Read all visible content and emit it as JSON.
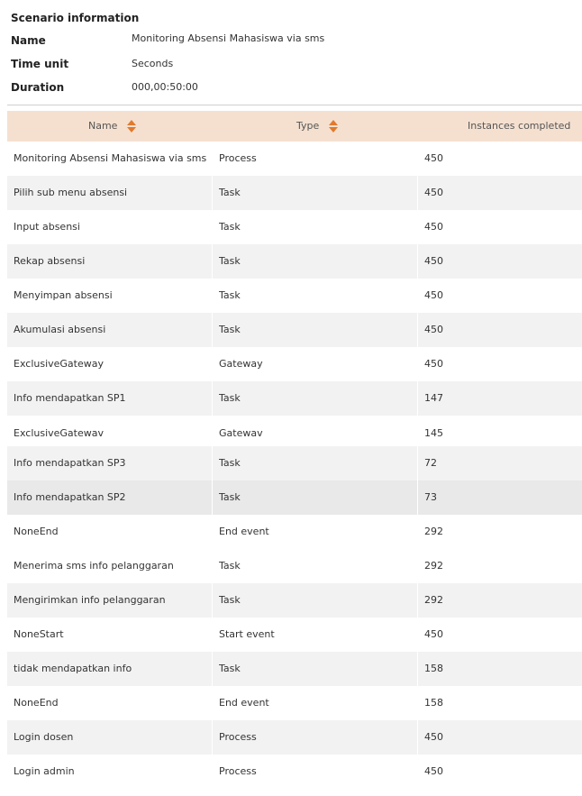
{
  "scenario": {
    "title": "Scenario information",
    "fields": [
      {
        "label": "Name",
        "value": "Monitoring Absensi Mahasiswa via sms"
      },
      {
        "label": "Time unit",
        "value": "Seconds"
      },
      {
        "label": "Duration",
        "value": "000,00:50:00"
      }
    ]
  },
  "table": {
    "headers": {
      "name": "Name",
      "type": "Type",
      "instances": "Instances completed"
    },
    "rows": [
      {
        "name": "Monitoring Absensi Mahasiswa via sms",
        "type": "Process",
        "instances": "450"
      },
      {
        "name": "Pilih sub menu absensi",
        "type": "Task",
        "instances": "450"
      },
      {
        "name": "Input absensi",
        "type": "Task",
        "instances": "450"
      },
      {
        "name": "Rekap absensi",
        "type": "Task",
        "instances": "450"
      },
      {
        "name": "Menyimpan absensi",
        "type": "Task",
        "instances": "450"
      },
      {
        "name": "Akumulasi absensi",
        "type": "Task",
        "instances": "450"
      },
      {
        "name": "ExclusiveGateway",
        "type": "Gateway",
        "instances": "450"
      },
      {
        "name": "Info mendapatkan SP1",
        "type": "Task",
        "instances": "147"
      },
      {
        "name": "ExclusiveGatewav",
        "type": "Gatewav",
        "instances": "145"
      },
      {
        "name": "Info mendapatkan SP3",
        "type": "Task",
        "instances": "72"
      },
      {
        "name": "Info mendapatkan SP2",
        "type": "Task",
        "instances": "73"
      },
      {
        "name": "NoneEnd",
        "type": "End event",
        "instances": "292"
      },
      {
        "name": "Menerima sms info pelanggaran",
        "type": "Task",
        "instances": "292"
      },
      {
        "name": "Mengirimkan info pelanggaran",
        "type": "Task",
        "instances": "292"
      },
      {
        "name": "NoneStart",
        "type": "Start event",
        "instances": "450"
      },
      {
        "name": "tidak mendapatkan info",
        "type": "Task",
        "instances": "158"
      },
      {
        "name": "NoneEnd",
        "type": "End event",
        "instances": "158"
      },
      {
        "name": "Login dosen",
        "type": "Process",
        "instances": "450"
      },
      {
        "name": "Login admin",
        "type": "Process",
        "instances": "450"
      }
    ]
  }
}
